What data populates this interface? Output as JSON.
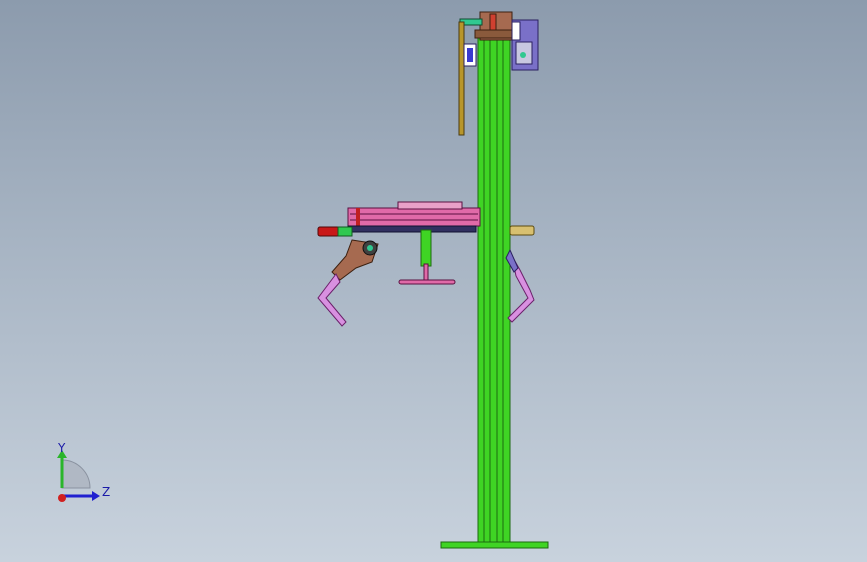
{
  "viewport": {
    "background_top": "#8c9bad",
    "background_bottom": "#c8d2dd"
  },
  "model": {
    "column_color": "#3fd424",
    "beam_color": "#e06aa8",
    "mount_color": "#8a5a3c",
    "motor_color": "#7a70c8",
    "rod_color": "#b8962a"
  },
  "triad": {
    "y_label": "Y",
    "z_label": "Z",
    "y_color": "#2ab52a",
    "z_color": "#2020d0",
    "x_color": "#d02020"
  }
}
